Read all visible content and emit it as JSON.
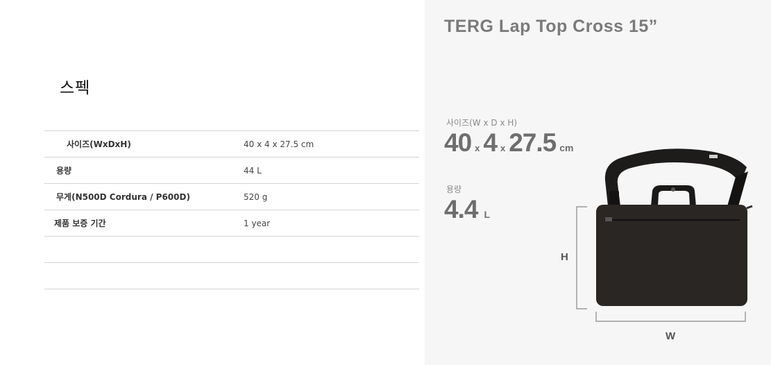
{
  "spec": {
    "title": "스펙",
    "rows": [
      {
        "label": "사이즈(WxDxH)",
        "value": "40 x 4 x 27.5 cm"
      },
      {
        "label": "용량",
        "value": "44 L"
      },
      {
        "label": "무게(N500D Cordura / P600D)",
        "value": "520 g"
      },
      {
        "label": "제품 보증 기간",
        "value": "1 year"
      },
      {
        "label": "",
        "value": ""
      },
      {
        "label": "",
        "value": ""
      }
    ]
  },
  "product": {
    "title": "TERG Lap Top Cross 15”",
    "size": {
      "label": "사이즈(W x D x H)",
      "w": "40",
      "x1": "x",
      "d": "4",
      "x2": "x",
      "h": "27.5",
      "unit": "cm"
    },
    "volume": {
      "label": "용량",
      "value": "4.4",
      "unit": "L"
    },
    "dimension_labels": {
      "height": "H",
      "width": "W"
    }
  },
  "colors": {
    "bag": "#2a2624",
    "strap": "#1e1c1b",
    "title_gray": "#7a7a7a",
    "panel_bg": "#f6f6f6"
  },
  "icons": {
    "bag": "laptop-bag-illustration"
  }
}
